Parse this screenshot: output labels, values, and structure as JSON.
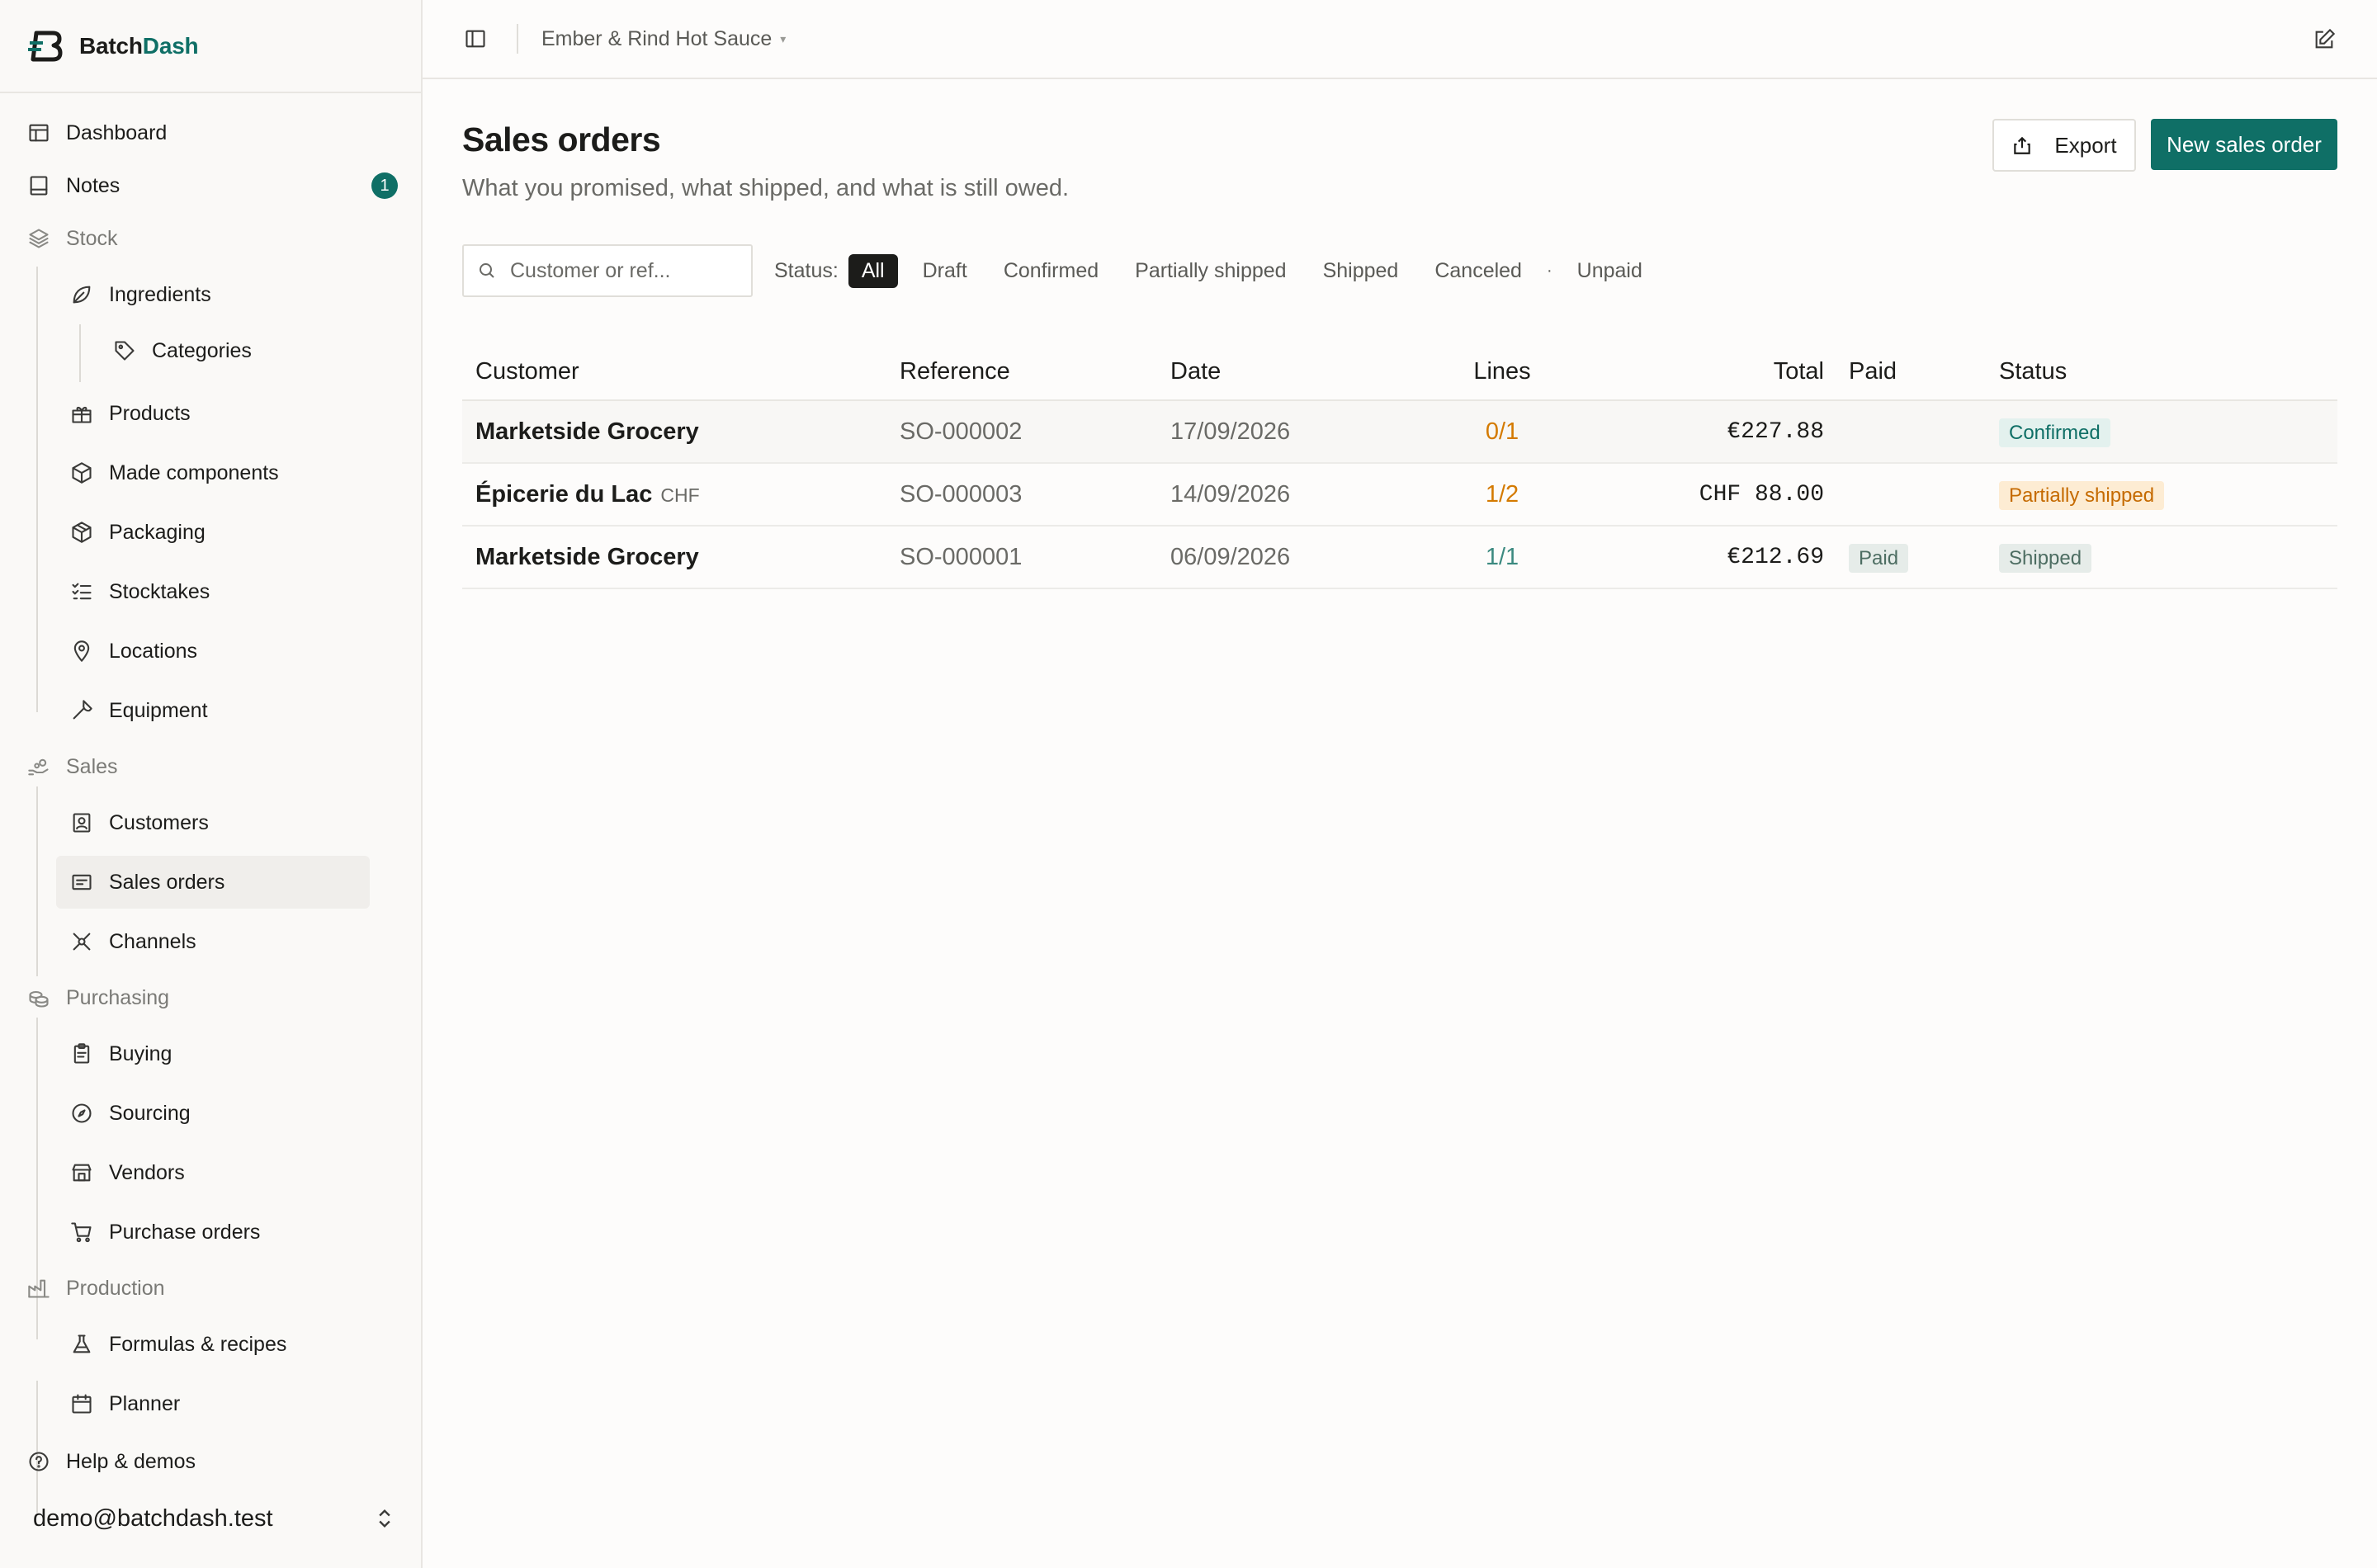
{
  "brand": {
    "name_part1": "Batch",
    "name_part2": "Dash"
  },
  "sidebar": {
    "dashboard": "Dashboard",
    "notes": "Notes",
    "notes_badge": "1",
    "stock": "Stock",
    "ingredients": "Ingredients",
    "categories": "Categories",
    "products": "Products",
    "made_components": "Made components",
    "packaging": "Packaging",
    "stocktakes": "Stocktakes",
    "locations": "Locations",
    "equipment": "Equipment",
    "sales": "Sales",
    "customers": "Customers",
    "sales_orders": "Sales orders",
    "channels": "Channels",
    "purchasing": "Purchasing",
    "buying": "Buying",
    "sourcing": "Sourcing",
    "vendors": "Vendors",
    "purchase_orders": "Purchase orders",
    "production": "Production",
    "formulas": "Formulas & recipes",
    "planner": "Planner",
    "help": "Help & demos",
    "account": "demo@batchdash.test"
  },
  "topbar": {
    "workspace": "Ember & Rind Hot Sauce",
    "caret": "▾"
  },
  "page": {
    "title": "Sales orders",
    "subtitle": "What you promised, what shipped, and what is still owed.",
    "export_label": "Export",
    "new_label": "New sales order"
  },
  "filters": {
    "search_placeholder": "Customer or ref...",
    "status_label": "Status:",
    "all": "All",
    "draft": "Draft",
    "confirmed": "Confirmed",
    "partially_shipped": "Partially shipped",
    "shipped": "Shipped",
    "canceled": "Canceled",
    "dot": "·",
    "unpaid": "Unpaid"
  },
  "table": {
    "headers": {
      "customer": "Customer",
      "reference": "Reference",
      "date": "Date",
      "lines": "Lines",
      "total": "Total",
      "paid": "Paid",
      "status": "Status"
    },
    "rows": [
      {
        "customer": "Marketside Grocery",
        "currency": "",
        "reference": "SO-000002",
        "date": "17/09/2026",
        "lines": "0/1",
        "total": "€227.88",
        "paid": "",
        "status": "Confirmed"
      },
      {
        "customer": "Épicerie du Lac",
        "currency": "CHF",
        "reference": "SO-000003",
        "date": "14/09/2026",
        "lines": "1/2",
        "total": "CHF 88.00",
        "paid": "",
        "status": "Partially shipped"
      },
      {
        "customer": "Marketside Grocery",
        "currency": "",
        "reference": "SO-000001",
        "date": "06/09/2026",
        "lines": "1/1",
        "total": "€212.69",
        "paid": "Paid",
        "status": "Shipped"
      }
    ]
  },
  "colors": {
    "accent": "#0f6f66",
    "warning": "#d47a00"
  }
}
